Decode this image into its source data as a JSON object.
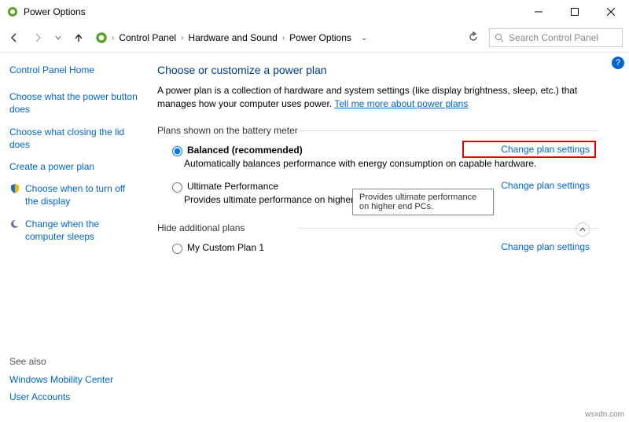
{
  "window": {
    "title": "Power Options"
  },
  "breadcrumb": {
    "seg1": "Control Panel",
    "seg2": "Hardware and Sound",
    "seg3": "Power Options"
  },
  "search": {
    "placeholder": "Search Control Panel"
  },
  "sidebar": {
    "home": "Control Panel Home",
    "link1": "Choose what the power button does",
    "link2": "Choose what closing the lid does",
    "link3": "Create a power plan",
    "link4": "Choose when to turn off the display",
    "link5": "Change when the computer sleeps"
  },
  "main": {
    "heading": "Choose or customize a power plan",
    "intro1": "A power plan is a collection of hardware and system settings (like display brightness, sleep, etc.) that manages how your computer uses power. ",
    "intro_link": "Tell me more about power plans",
    "section1": "Plans shown on the battery meter",
    "plan_balanced": {
      "name": "Balanced (recommended)",
      "desc": "Automatically balances performance with energy consumption on capable hardware.",
      "change": "Change plan settings"
    },
    "plan_ultimate": {
      "name": "Ultimate Performance",
      "desc": "Provides ultimate performance on higher en",
      "change": "Change plan settings"
    },
    "section2": "Hide additional plans",
    "plan_custom": {
      "name": "My Custom Plan 1",
      "change": "Change plan settings"
    }
  },
  "tooltip": "Provides ultimate performance on higher end PCs.",
  "seealso": {
    "heading": "See also",
    "link1": "Windows Mobility Center",
    "link2": "User Accounts"
  },
  "help_badge": "?",
  "watermark": "wsxdn.com"
}
